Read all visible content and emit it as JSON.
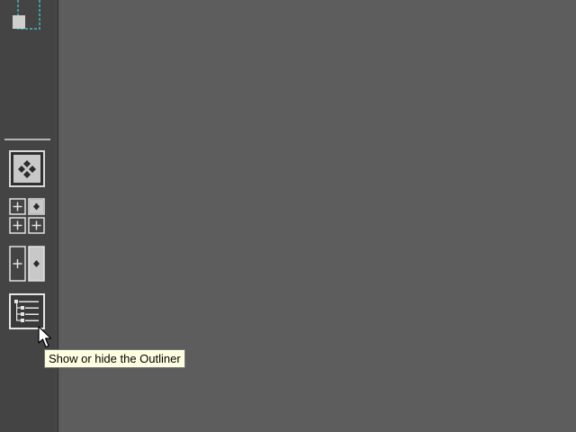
{
  "tooltip": {
    "text": "Show or hide the Outliner"
  },
  "toolbox": {
    "buttons": [
      {
        "name": "select-object-tool",
        "icon": "select-object-icon"
      },
      {
        "name": "single-perspective-view",
        "icon": "single-view-icon"
      },
      {
        "name": "four-view-layout",
        "icon": "four-view-icon"
      },
      {
        "name": "persp-outliner-layout",
        "icon": "side-by-side-view-icon"
      },
      {
        "name": "outliner-toggle",
        "icon": "outliner-icon"
      }
    ]
  },
  "colors": {
    "toolbox_bg": "#444444",
    "viewport_bg": "#5d5d5d",
    "tooltip_bg": "#ffffe1",
    "select_tool_accent": "#3fb9c4"
  }
}
